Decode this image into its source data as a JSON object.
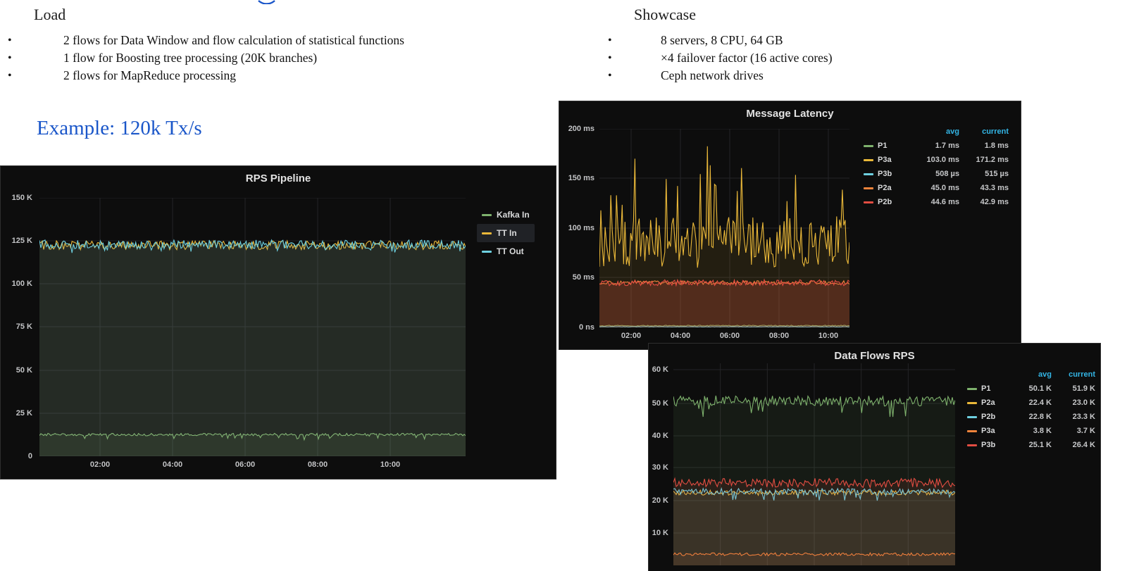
{
  "slide": {
    "load": {
      "title": "Load",
      "items": [
        "2 flows for Data Window and flow calculation of statistical functions",
        "1 flow for Boosting tree processing (20K branches)",
        "2 flows for MapReduce processing"
      ]
    },
    "showcase": {
      "title": "Showcase",
      "items": [
        "8 servers, 8 CPU, 64 GB",
        "×4 failover factor (16 active cores)",
        "Ceph network drives"
      ]
    },
    "example_heading": "Example: 120k Tx/s"
  },
  "theme": {
    "panel_bg": "#0d0d0d",
    "grid_color": "#242426",
    "axis_text": "#c3c4c6",
    "title_text": "#e3e3e3",
    "legend_header_blue": "#33b5e5",
    "slide_accent_blue": "#1a56c9"
  },
  "chart_data": [
    {
      "type": "line",
      "title": "RPS Pipeline",
      "ylim": [
        0,
        150000
      ],
      "y_ticks": [
        "150 K",
        "125 K",
        "100 K",
        "75 K",
        "50 K",
        "25 K",
        "0"
      ],
      "x_ticks": [
        "02:00",
        "04:00",
        "06:00",
        "08:00",
        "10:00"
      ],
      "grid": true,
      "legend_position": "right",
      "series": [
        {
          "name": "Kafka In",
          "color": "#7eb26d",
          "level": 12600,
          "amp": 700,
          "seed": 101,
          "spike_chance": 0.05,
          "spike_amp": -2600,
          "fill": 0.1
        },
        {
          "name": "TT In",
          "color": "#eab839",
          "level": 122500,
          "amp": 2600,
          "seed": 102,
          "fill": 0.07,
          "highlight": true
        },
        {
          "name": "TT Out",
          "color": "#6ed0e0",
          "level": 123000,
          "amp": 2600,
          "seed": 103,
          "spike_chance": 0.05,
          "spike_amp": -4000,
          "fill": 0.1
        }
      ]
    },
    {
      "type": "line",
      "title": "Message Latency",
      "ylim": [
        0,
        200
      ],
      "y_ticks": [
        "200 ms",
        "150 ms",
        "100 ms",
        "50 ms",
        "0 ns"
      ],
      "x_ticks": [
        "02:00",
        "04:00",
        "06:00",
        "08:00",
        "10:00"
      ],
      "grid": true,
      "legend_position": "right",
      "legend_headers": [
        "avg",
        "current"
      ],
      "series": [
        {
          "name": "P1",
          "color": "#7eb26d",
          "avg": "1.7 ms",
          "current": "1.8 ms",
          "level": 1.7,
          "amp": 0.5,
          "seed": 201,
          "fill": 0
        },
        {
          "name": "P3a",
          "color": "#eab839",
          "avg": "103.0 ms",
          "current": "171.2 ms",
          "level": 86,
          "amp": 26,
          "seed": 202,
          "spike_chance": 0.15,
          "spike_amp": 85,
          "fill": 0.1
        },
        {
          "name": "P3b",
          "color": "#6ed0e0",
          "avg": "508 µs",
          "current": "515 µs",
          "level": 0.6,
          "amp": 0.2,
          "seed": 203,
          "fill": 0
        },
        {
          "name": "P2a",
          "color": "#ef843c",
          "avg": "45.0 ms",
          "current": "43.3 ms",
          "level": 45,
          "amp": 2,
          "seed": 204,
          "fill": 0.1
        },
        {
          "name": "P2b",
          "color": "#e24d42",
          "avg": "44.6 ms",
          "current": "42.9 ms",
          "level": 45,
          "amp": 3,
          "seed": 205,
          "fill": 0.16
        }
      ]
    },
    {
      "type": "line",
      "title": "Data Flows RPS",
      "ylim": [
        0,
        62000
      ],
      "y_ticks": [
        "60 K",
        "50 K",
        "40 K",
        "30 K",
        "20 K",
        "10 K"
      ],
      "x_ticks": [],
      "grid": true,
      "legend_position": "right",
      "legend_headers": [
        "avg",
        "current"
      ],
      "series": [
        {
          "name": "P1",
          "color": "#7eb26d",
          "avg": "50.1 K",
          "current": "51.9 K",
          "level": 50500,
          "amp": 1600,
          "seed": 301,
          "spike_chance": 0.06,
          "spike_amp": -5200,
          "fill": 0.09
        },
        {
          "name": "P2a",
          "color": "#eab839",
          "avg": "22.4 K",
          "current": "23.0 K",
          "level": 22300,
          "amp": 800,
          "seed": 302,
          "fill": 0.06
        },
        {
          "name": "P2b",
          "color": "#6ed0e0",
          "avg": "22.8 K",
          "current": "23.3 K",
          "level": 22600,
          "amp": 1000,
          "seed": 303,
          "spike_chance": 0.04,
          "spike_amp": -3000,
          "fill": 0.07
        },
        {
          "name": "P3a",
          "color": "#ef843c",
          "avg": "3.8 K",
          "current": "3.7 K",
          "level": 3400,
          "amp": 450,
          "seed": 304,
          "fill": 0.08
        },
        {
          "name": "P3b",
          "color": "#e24d42",
          "avg": "25.1 K",
          "current": "26.4 K",
          "level": 25300,
          "amp": 1400,
          "seed": 305,
          "fill": 0.1
        }
      ]
    }
  ]
}
